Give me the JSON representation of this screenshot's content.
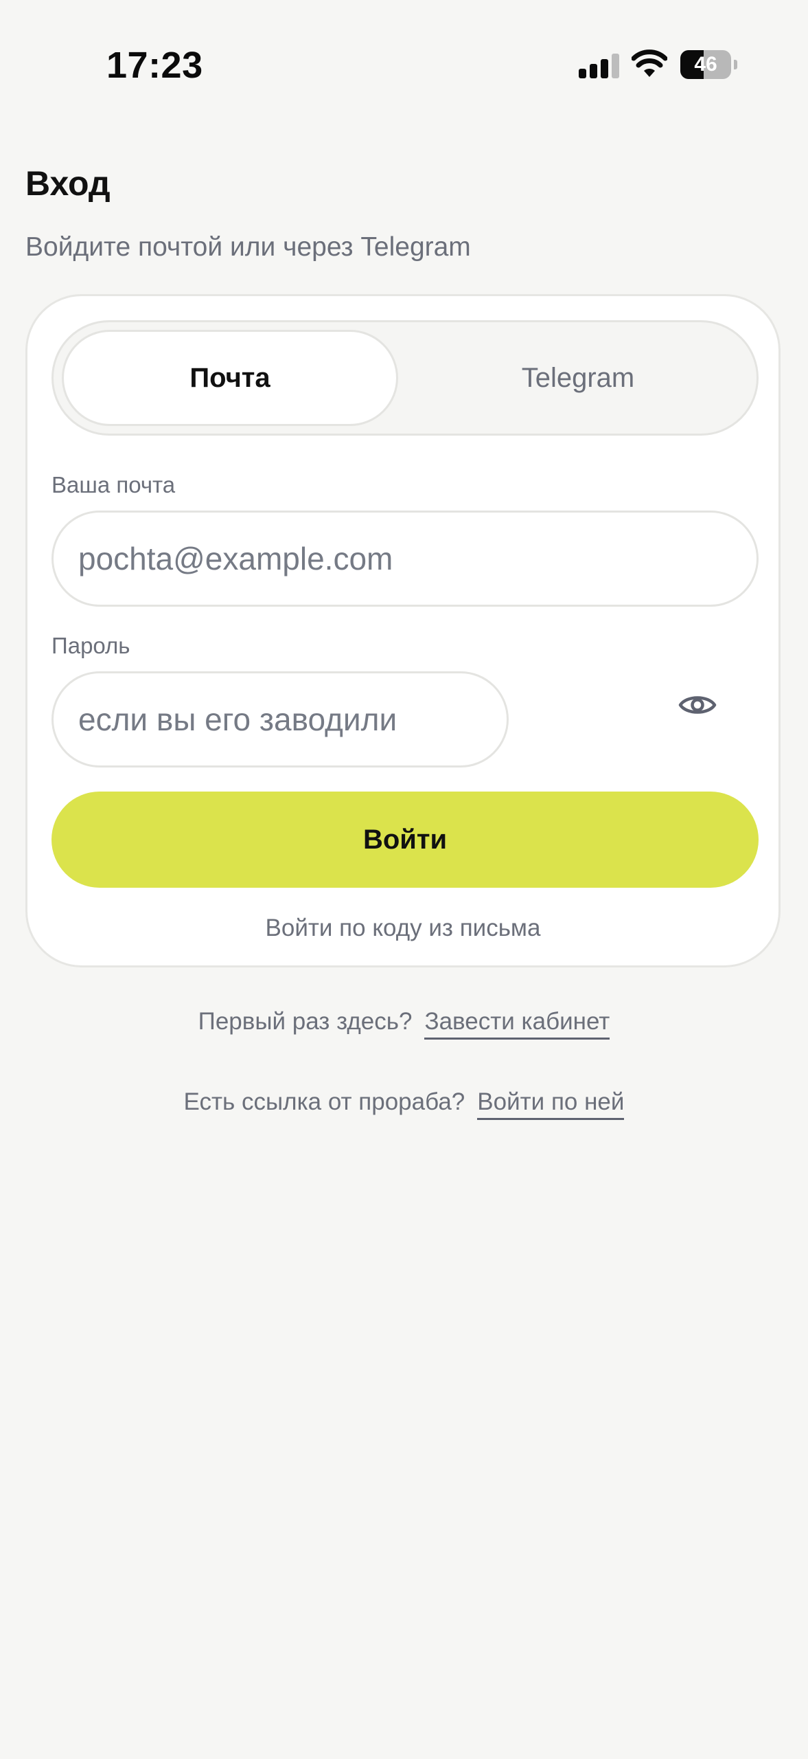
{
  "status_bar": {
    "time": "17:23",
    "battery_level": "46",
    "battery_fraction": 0.46,
    "signal_bars_filled": 3,
    "signal_bars_total": 4
  },
  "header": {
    "title": "Вход",
    "subtitle": "Войдите почтой или через Telegram"
  },
  "tabs": {
    "email": "Почта",
    "telegram": "Telegram",
    "selected": "email"
  },
  "form": {
    "email_label": "Ваша почта",
    "email_placeholder": "pochta@example.com",
    "email_value": "",
    "password_label": "Пароль",
    "password_placeholder": "если вы его заводили",
    "password_value": "",
    "password_toggle_icon": "eye-icon",
    "submit_label": "Войти",
    "code_login_label": "Войти по коду из письма"
  },
  "footer": {
    "signup_prompt": "Первый раз здесь?",
    "signup_link": "Завести кабинет",
    "foreman_prompt": "Есть ссылка от прораба?",
    "foreman_link": "Войти по ней"
  },
  "colors": {
    "background": "#f6f6f4",
    "accent": "#dbe34c",
    "muted_text": "#6b6f7a"
  }
}
